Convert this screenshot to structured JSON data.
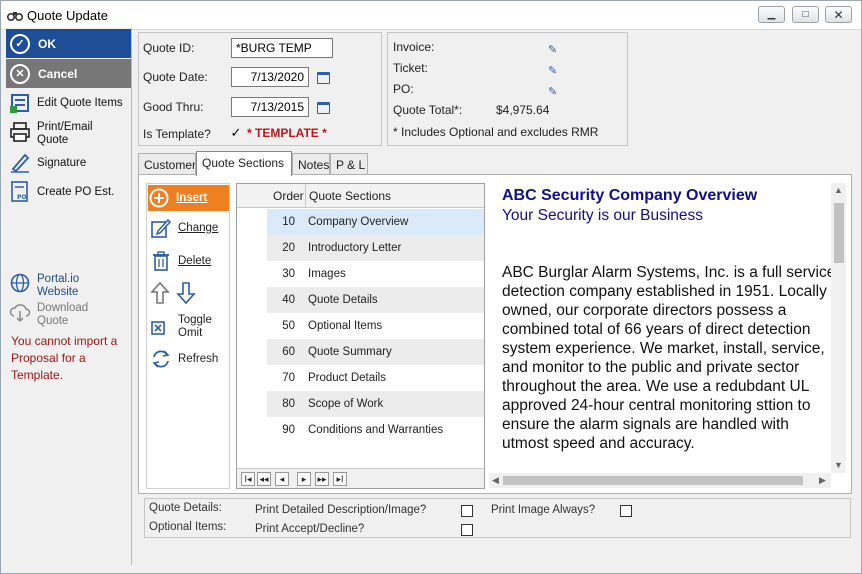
{
  "window": {
    "title": "Quote Update",
    "minimize": "▁",
    "maximize": "□",
    "close": "✕"
  },
  "sidebar": {
    "ok": "OK",
    "cancel": "Cancel",
    "items": [
      {
        "label": "Edit Quote Items"
      },
      {
        "label": "Print/Email Quote"
      },
      {
        "label": "Signature"
      },
      {
        "label": "Create PO Est."
      }
    ],
    "portal": "Portal.io Website",
    "download": "Download Quote",
    "import_msg": "You cannot import a Proposal for a Template."
  },
  "quote": {
    "id_label": "Quote ID:",
    "id_value": "*BURG TEMP",
    "date_label": "Quote Date:",
    "date_value": "7/13/2020",
    "thru_label": "Good Thru:",
    "thru_value": "7/13/2015",
    "template_label": "Is Template?",
    "template_checked": "✓",
    "template_text": "* TEMPLATE *"
  },
  "info": {
    "invoice": "Invoice:",
    "ticket": "Ticket:",
    "po": "PO:",
    "total_label": "Quote Total*:",
    "total_value": "$4,975.64",
    "note": "* Includes Optional and excludes RMR"
  },
  "tabs": [
    {
      "label": "Customer"
    },
    {
      "label": "Quote Sections"
    },
    {
      "label": "Notes"
    },
    {
      "label": "P & L"
    }
  ],
  "actions": {
    "insert": "Insert",
    "change": "Change",
    "delete": "Delete",
    "toggle": "Toggle Omit",
    "refresh": "Refresh"
  },
  "grid": {
    "headers": [
      "Order",
      "Quote Sections"
    ],
    "rows": [
      {
        "order": "10",
        "section": "Company Overview"
      },
      {
        "order": "20",
        "section": "Introductory Letter"
      },
      {
        "order": "30",
        "section": "Images"
      },
      {
        "order": "40",
        "section": "Quote Details"
      },
      {
        "order": "50",
        "section": "Optional Items"
      },
      {
        "order": "60",
        "section": "Quote Summary"
      },
      {
        "order": "70",
        "section": "Product Details"
      },
      {
        "order": "80",
        "section": "Scope of Work"
      },
      {
        "order": "90",
        "section": "Conditions and Warranties"
      }
    ],
    "nav": [
      "I◂",
      "◂◂",
      "◂",
      "▸",
      "▸▸",
      "▸I"
    ]
  },
  "preview": {
    "title": "ABC Security Company Overview",
    "subtitle": "Your Security is our Business",
    "body": "ABC Burglar Alarm Systems, Inc. is a full service detection company established in 1951. Locally owned, our corporate directors possess a combined total of 66 years of direct detection system experience. We market, install, service, and monitor to the public and private sector throughout the area. We use a redubdant UL approved 24-hour central monitoring sttion to ensure the alarm signals are handled with utmost speed and accuracy."
  },
  "bottom": {
    "qd_label": "Quote Details:",
    "print_desc": "Print Detailed Description/Image?",
    "print_img": "Print Image Always?",
    "oi_label": "Optional Items:",
    "print_accept": "Print Accept/Decline?"
  },
  "colors": {
    "accent": "#1d4e96",
    "insert": "#f07f22",
    "template_red": "#c0161b",
    "preview_blue": "#10108a",
    "selected_row": "#dbeaf8",
    "alt_row": "#ececec"
  }
}
